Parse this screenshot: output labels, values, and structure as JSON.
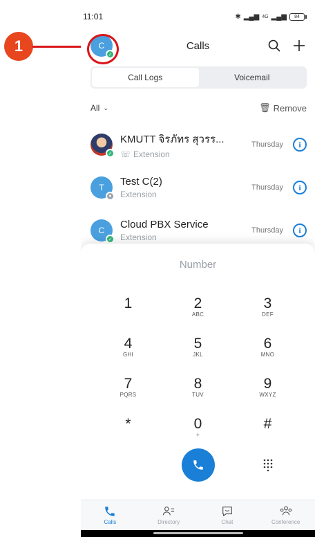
{
  "annotation": {
    "marker_label": "1"
  },
  "status_bar": {
    "time": "11:01",
    "network": "4G",
    "battery": "84"
  },
  "header": {
    "avatar_initial": "C",
    "title": "Calls"
  },
  "tabs": [
    {
      "label": "Call Logs",
      "active": true
    },
    {
      "label": "Voicemail",
      "active": false
    }
  ],
  "filter": {
    "label": "All",
    "remove_label": "Remove"
  },
  "calls": [
    {
      "name": "KMUTT จิรภัทร สุวรร...",
      "type": "Extension",
      "date": "Thursday",
      "avatar": "photo",
      "presence": "online",
      "avatar_initial": ""
    },
    {
      "name": "Test C(2)",
      "type": "Extension",
      "date": "Thursday",
      "avatar": "initial",
      "presence": "offline",
      "avatar_initial": "T"
    },
    {
      "name": "Cloud PBX Service",
      "type": "Extension",
      "date": "Thursday",
      "avatar": "initial",
      "presence": "online",
      "avatar_initial": "C"
    }
  ],
  "dialpad": {
    "placeholder": "Number",
    "keys": [
      {
        "digit": "1",
        "letters": ""
      },
      {
        "digit": "2",
        "letters": "ABC"
      },
      {
        "digit": "3",
        "letters": "DEF"
      },
      {
        "digit": "4",
        "letters": "GHI"
      },
      {
        "digit": "5",
        "letters": "JKL"
      },
      {
        "digit": "6",
        "letters": "MNO"
      },
      {
        "digit": "7",
        "letters": "PQRS"
      },
      {
        "digit": "8",
        "letters": "TUV"
      },
      {
        "digit": "9",
        "letters": "WXYZ"
      },
      {
        "digit": "*",
        "letters": ""
      },
      {
        "digit": "0",
        "letters": "+"
      },
      {
        "digit": "#",
        "letters": ""
      }
    ]
  },
  "nav": [
    {
      "label": "Calls",
      "icon": "phone-icon",
      "active": true
    },
    {
      "label": "Directory",
      "icon": "directory-icon",
      "active": false
    },
    {
      "label": "Chat",
      "icon": "chat-icon",
      "active": false
    },
    {
      "label": "Conference",
      "icon": "conference-icon",
      "active": false
    }
  ],
  "colors": {
    "accent": "#1a7fd6",
    "annotation": "#e8461e",
    "online": "#33b57a"
  }
}
